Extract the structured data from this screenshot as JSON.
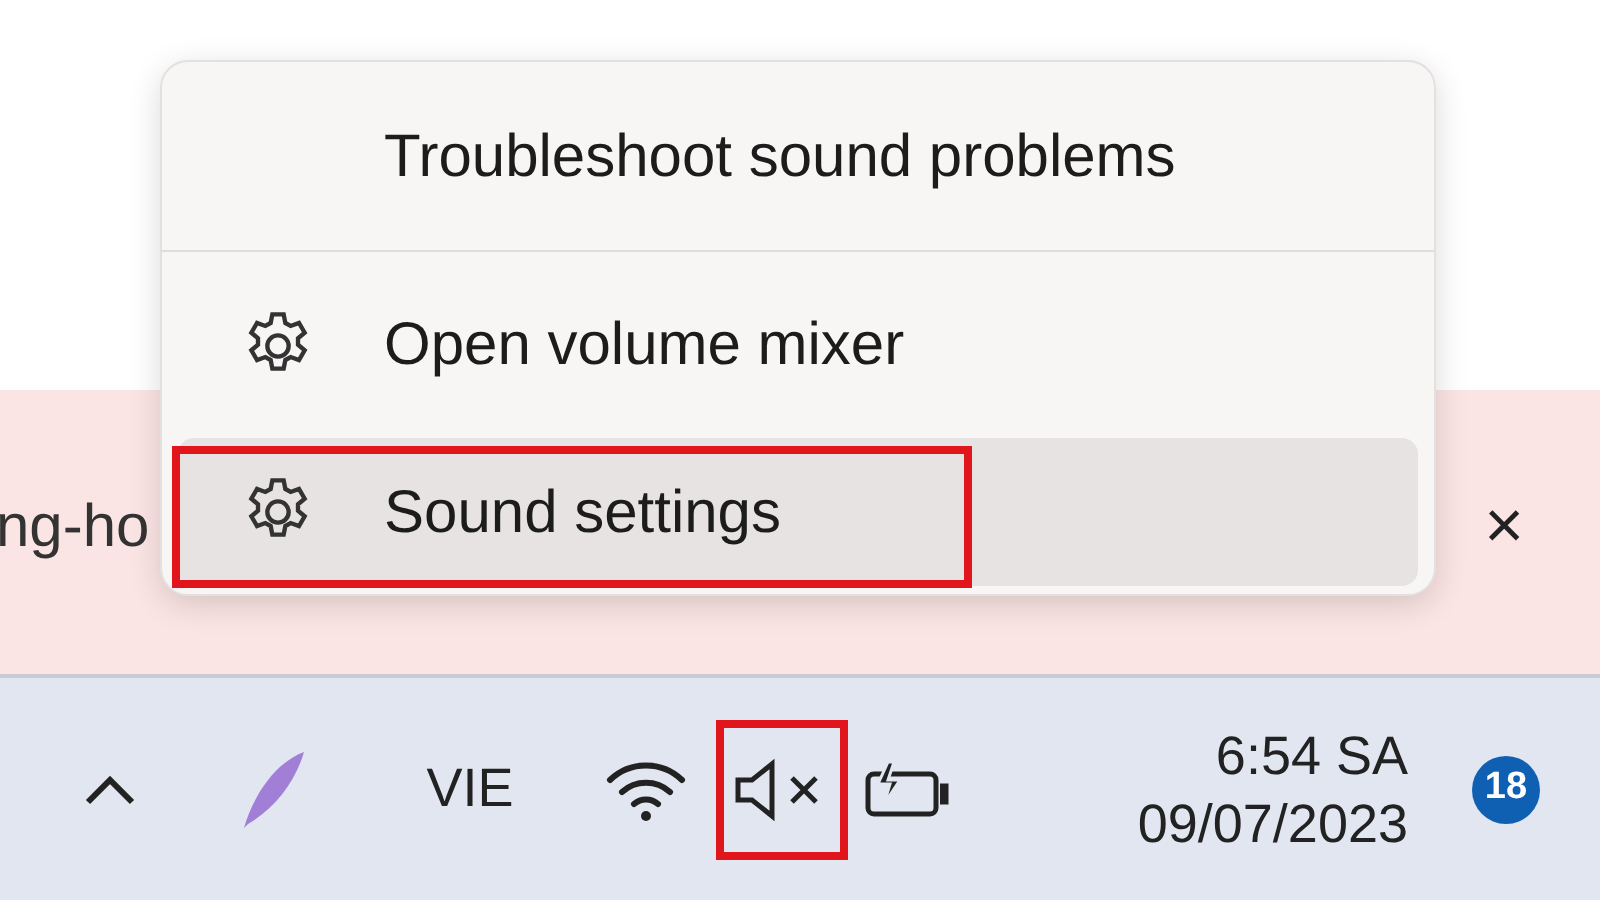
{
  "notification_bar": {
    "text": "ng-ho",
    "close": "×"
  },
  "context_menu": {
    "items": [
      {
        "label": "Troubleshoot sound problems",
        "has_icon": false,
        "selected": false,
        "annotated": false,
        "divider_after": true
      },
      {
        "label": "Open volume mixer",
        "has_icon": true,
        "selected": false,
        "annotated": false,
        "divider_after": false
      },
      {
        "label": "Sound settings",
        "has_icon": true,
        "selected": true,
        "annotated": true,
        "divider_after": false
      }
    ]
  },
  "taskbar": {
    "tray": [
      {
        "kind": "chevron",
        "annotated": false
      },
      {
        "kind": "pen",
        "annotated": false
      },
      {
        "kind": "language",
        "label": "VIE",
        "annotated": false
      },
      {
        "kind": "wifi",
        "annotated": false
      },
      {
        "kind": "volume_muted",
        "annotated": true
      },
      {
        "kind": "battery",
        "annotated": false
      }
    ],
    "time": "6:54 SA",
    "date": "09/07/2023",
    "notification_count": "18"
  }
}
